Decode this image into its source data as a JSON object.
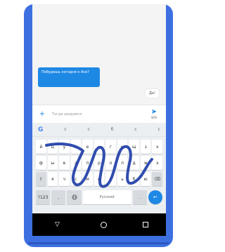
{
  "colors": {
    "frame": "#3d6fe0",
    "accent": "#1e88e5",
    "swipe_trail": "#1f3ea8",
    "keyboard_bg": "#eceff1"
  },
  "chat": {
    "outgoing_message": "Побудешь сегодня к Асе?",
    "incoming_message": "Да!"
  },
  "compose": {
    "placeholder": "Тогда увидимся",
    "send_label": "SMS",
    "add_icon": "plus-icon",
    "send_icon": "send-icon"
  },
  "keyboard": {
    "suggestions": [
      "G",
      "с",
      "с",
      "б",
      "с",
      "с"
    ],
    "row1": [
      "й",
      "ц",
      "у",
      "к",
      "е",
      "н",
      "г",
      "ш",
      "щ",
      "з",
      "х"
    ],
    "row2": [
      "ф",
      "ы",
      "в",
      "а",
      "п",
      "р",
      "о",
      "л",
      "д",
      "ж",
      "э"
    ],
    "row3": [
      "⇧",
      "я",
      "ч",
      "с",
      "м",
      "и",
      "т",
      "ь",
      "б",
      "ю",
      "⌫"
    ],
    "row4": {
      "symbols": "?123",
      "comma": ",",
      "globe": "globe-icon",
      "space": "Русский",
      "period": ".",
      "enter": "enter-icon"
    }
  },
  "navbar": {
    "back": "back-icon",
    "home": "home-icon",
    "recent": "recent-apps-icon"
  }
}
